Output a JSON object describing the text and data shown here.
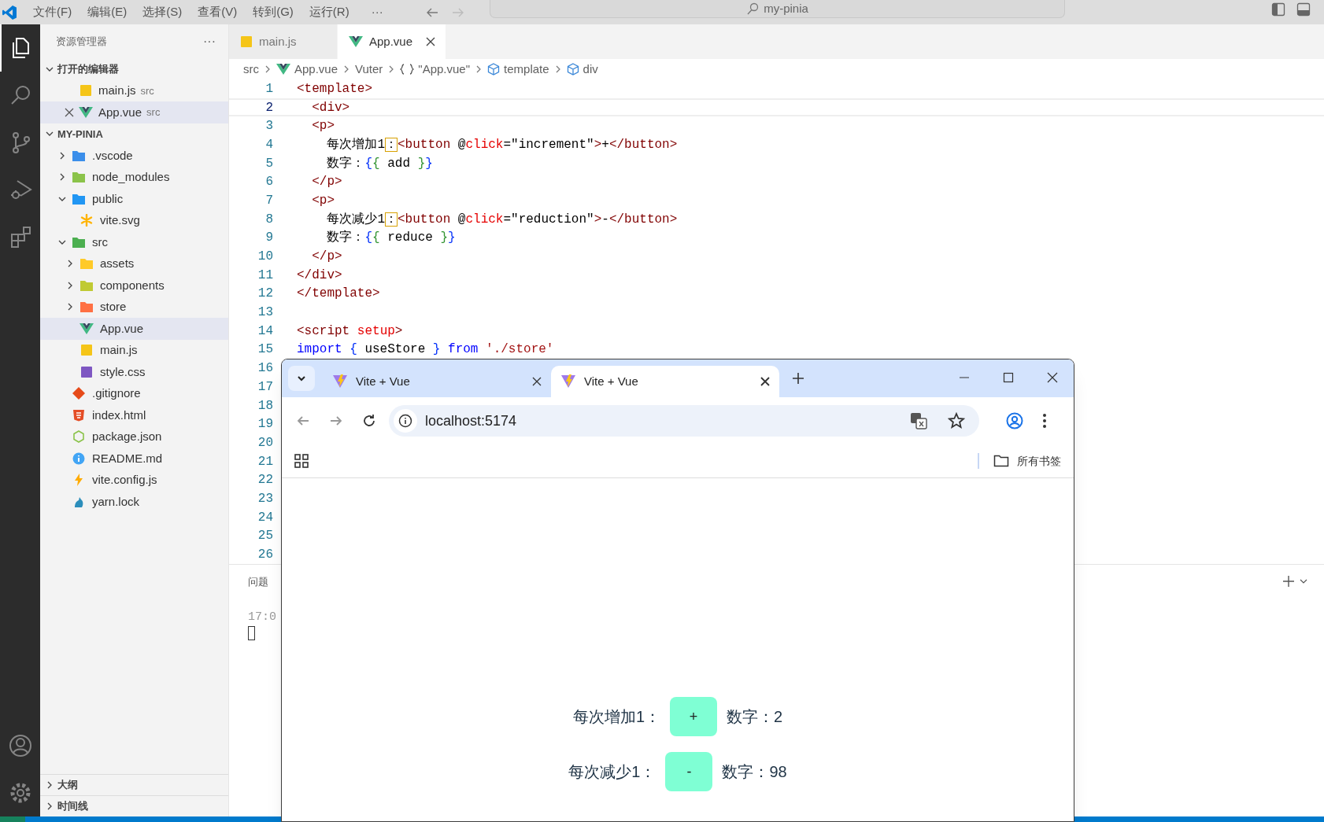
{
  "title_bar": {
    "menu": [
      "文件(F)",
      "编辑(E)",
      "选择(S)",
      "查看(V)",
      "转到(G)",
      "运行(R)"
    ],
    "more": "···",
    "search": "my-pinia"
  },
  "activity_bar": [
    {
      "kind": "files",
      "selected": true
    },
    {
      "kind": "search",
      "selected": false
    },
    {
      "kind": "source-control",
      "selected": false
    },
    {
      "kind": "run",
      "selected": false
    },
    {
      "kind": "extensions",
      "selected": false
    }
  ],
  "activity_bar_bottom": [
    {
      "kind": "account"
    },
    {
      "kind": "settings"
    }
  ],
  "explorer": {
    "title": "资源管理器",
    "more": "···",
    "open_editors": {
      "label": "打开的编辑器",
      "expanded": true,
      "items": [
        {
          "name": "main.js",
          "folder": "src",
          "kind": "js",
          "selected": false
        },
        {
          "name": "App.vue",
          "folder": "src",
          "kind": "vue",
          "selected": true
        }
      ]
    },
    "project": {
      "label": "MY-PINIA",
      "expanded": true,
      "children": [
        {
          "name": ".vscode",
          "kind": "folder-vscode",
          "expanded": false,
          "selected": false
        },
        {
          "name": "node_modules",
          "kind": "folder-node",
          "expanded": false,
          "selected": false
        },
        {
          "name": "public",
          "kind": "folder-public",
          "expanded": true,
          "selected": false,
          "children": [
            {
              "name": "vite.svg",
              "kind": "svg",
              "selected": false
            }
          ]
        },
        {
          "name": "src",
          "kind": "folder-src",
          "expanded": true,
          "selected": false,
          "children": [
            {
              "name": "assets",
              "kind": "folder-assets",
              "expanded": false,
              "selected": false
            },
            {
              "name": "components",
              "kind": "folder-components",
              "expanded": false,
              "selected": false
            },
            {
              "name": "store",
              "kind": "folder-store",
              "expanded": false,
              "selected": false
            },
            {
              "name": "App.vue",
              "kind": "vue",
              "selected": true
            },
            {
              "name": "main.js",
              "kind": "js",
              "selected": false
            },
            {
              "name": "style.css",
              "kind": "css",
              "selected": false
            }
          ]
        },
        {
          "name": ".gitignore",
          "kind": "git",
          "selected": false
        },
        {
          "name": "index.html",
          "kind": "html",
          "selected": false
        },
        {
          "name": "package.json",
          "kind": "json",
          "selected": false
        },
        {
          "name": "README.md",
          "kind": "info",
          "selected": false
        },
        {
          "name": "vite.config.js",
          "kind": "vite",
          "selected": false
        },
        {
          "name": "yarn.lock",
          "kind": "yarn",
          "selected": false
        }
      ]
    }
  },
  "bottom_sections": [
    {
      "label": "大纲",
      "expanded": false
    },
    {
      "label": "时间线",
      "expanded": false
    }
  ],
  "editor_tabs": [
    {
      "label": "main.js",
      "kind": "js",
      "selected": false
    },
    {
      "label": "App.vue",
      "kind": "vue",
      "selected": true
    }
  ],
  "breadcrumb": [
    {
      "label": "src"
    },
    {
      "label": "App.vue",
      "kind": "vue"
    },
    {
      "label": "Vuter"
    },
    {
      "label": "\"App.vue\"",
      "kind": "braces"
    },
    {
      "label": "template",
      "kind": "cube"
    },
    {
      "label": "div",
      "kind": "cube"
    }
  ],
  "code_lines": [
    {
      "number": "1",
      "current": false,
      "tokens": [
        {
          "text": "<template>",
          "kind": "tag"
        }
      ]
    },
    {
      "number": "2",
      "current": true,
      "tokens": [
        {
          "text": "  <div>",
          "kind": "tag"
        }
      ]
    },
    {
      "number": "3",
      "current": false,
      "tokens": [
        {
          "text": "  <p>",
          "kind": "tag"
        }
      ]
    },
    {
      "number": "4",
      "current": false,
      "tokens": [
        {
          "text": "    每次增加1",
          "kind": "text"
        },
        {
          "text": "：",
          "kind": "mark"
        },
        {
          "text": "<button",
          "kind": "tag"
        },
        {
          "text": " @",
          "kind": "text"
        },
        {
          "text": "click",
          "kind": "attr"
        },
        {
          "text": "=\"increment\"",
          "kind": "text"
        },
        {
          "text": ">",
          "kind": "tag"
        },
        {
          "text": "+",
          "kind": "text"
        },
        {
          "text": "</button>",
          "kind": "tag"
        }
      ]
    },
    {
      "number": "5",
      "current": false,
      "tokens": [
        {
          "text": "    数字：",
          "kind": "text"
        },
        {
          "text": "{",
          "kind": "bracket1"
        },
        {
          "text": "{",
          "kind": "bracket2"
        },
        {
          "text": " add ",
          "kind": "text"
        },
        {
          "text": "}",
          "kind": "bracket2"
        },
        {
          "text": "}",
          "kind": "bracket1"
        }
      ]
    },
    {
      "number": "6",
      "current": false,
      "tokens": [
        {
          "text": "  </p>",
          "kind": "tag"
        }
      ]
    },
    {
      "number": "7",
      "current": false,
      "tokens": [
        {
          "text": "  <p>",
          "kind": "tag"
        }
      ]
    },
    {
      "number": "8",
      "current": false,
      "tokens": [
        {
          "text": "    每次减少1",
          "kind": "text"
        },
        {
          "text": "：",
          "kind": "mark"
        },
        {
          "text": "<button",
          "kind": "tag"
        },
        {
          "text": " @",
          "kind": "text"
        },
        {
          "text": "click",
          "kind": "attr"
        },
        {
          "text": "=\"reduction\"",
          "kind": "text"
        },
        {
          "text": ">",
          "kind": "tag"
        },
        {
          "text": "-",
          "kind": "text"
        },
        {
          "text": "</button>",
          "kind": "tag"
        }
      ]
    },
    {
      "number": "9",
      "current": false,
      "tokens": [
        {
          "text": "    数字：",
          "kind": "text"
        },
        {
          "text": "{",
          "kind": "bracket1"
        },
        {
          "text": "{",
          "kind": "bracket2"
        },
        {
          "text": " reduce ",
          "kind": "text"
        },
        {
          "text": "}",
          "kind": "bracket2"
        },
        {
          "text": "}",
          "kind": "bracket1"
        }
      ]
    },
    {
      "number": "10",
      "current": false,
      "tokens": [
        {
          "text": "  </p>",
          "kind": "tag"
        }
      ]
    },
    {
      "number": "11",
      "current": false,
      "tokens": [
        {
          "text": "</div>",
          "kind": "tag"
        }
      ]
    },
    {
      "number": "12",
      "current": false,
      "tokens": [
        {
          "text": "</template>",
          "kind": "tag"
        }
      ]
    },
    {
      "number": "13",
      "current": false
    },
    {
      "number": "14",
      "current": false,
      "tokens": [
        {
          "text": "<script",
          "kind": "tag"
        },
        {
          "text": " setup",
          "kind": "attr"
        },
        {
          "text": ">",
          "kind": "tag"
        }
      ]
    },
    {
      "number": "15",
      "current": false,
      "tokens": [
        {
          "text": "import",
          "kind": "keyword"
        },
        {
          "text": " {",
          "kind": "bracket1"
        },
        {
          "text": " useStore ",
          "kind": "text"
        },
        {
          "text": "}",
          "kind": "bracket1"
        },
        {
          "text": " from",
          "kind": "keyword"
        },
        {
          "text": " './store'",
          "kind": "string"
        }
      ]
    },
    {
      "number": "16",
      "current": false
    },
    {
      "number": "17",
      "current": false
    },
    {
      "number": "18",
      "current": false
    },
    {
      "number": "19",
      "current": false
    },
    {
      "number": "20",
      "current": false
    },
    {
      "number": "21",
      "current": false
    },
    {
      "number": "22",
      "current": false
    },
    {
      "number": "23",
      "current": false
    },
    {
      "number": "24",
      "current": false
    },
    {
      "number": "25",
      "current": false
    },
    {
      "number": "26",
      "current": false
    }
  ],
  "panel": {
    "tab": "问题",
    "lines": [
      "17:0"
    ]
  },
  "browser": {
    "tabs": [
      {
        "title": "Vite + Vue",
        "selected": false
      },
      {
        "title": "Vite + Vue",
        "selected": true
      }
    ],
    "address": "localhost:5174",
    "bookmarks_label": "所有书签",
    "page_rows": [
      {
        "label": "每次增加1：",
        "button": "+",
        "value": "数字：2"
      },
      {
        "label": "每次减少1：",
        "button": "-",
        "value": "数字：98"
      }
    ]
  }
}
